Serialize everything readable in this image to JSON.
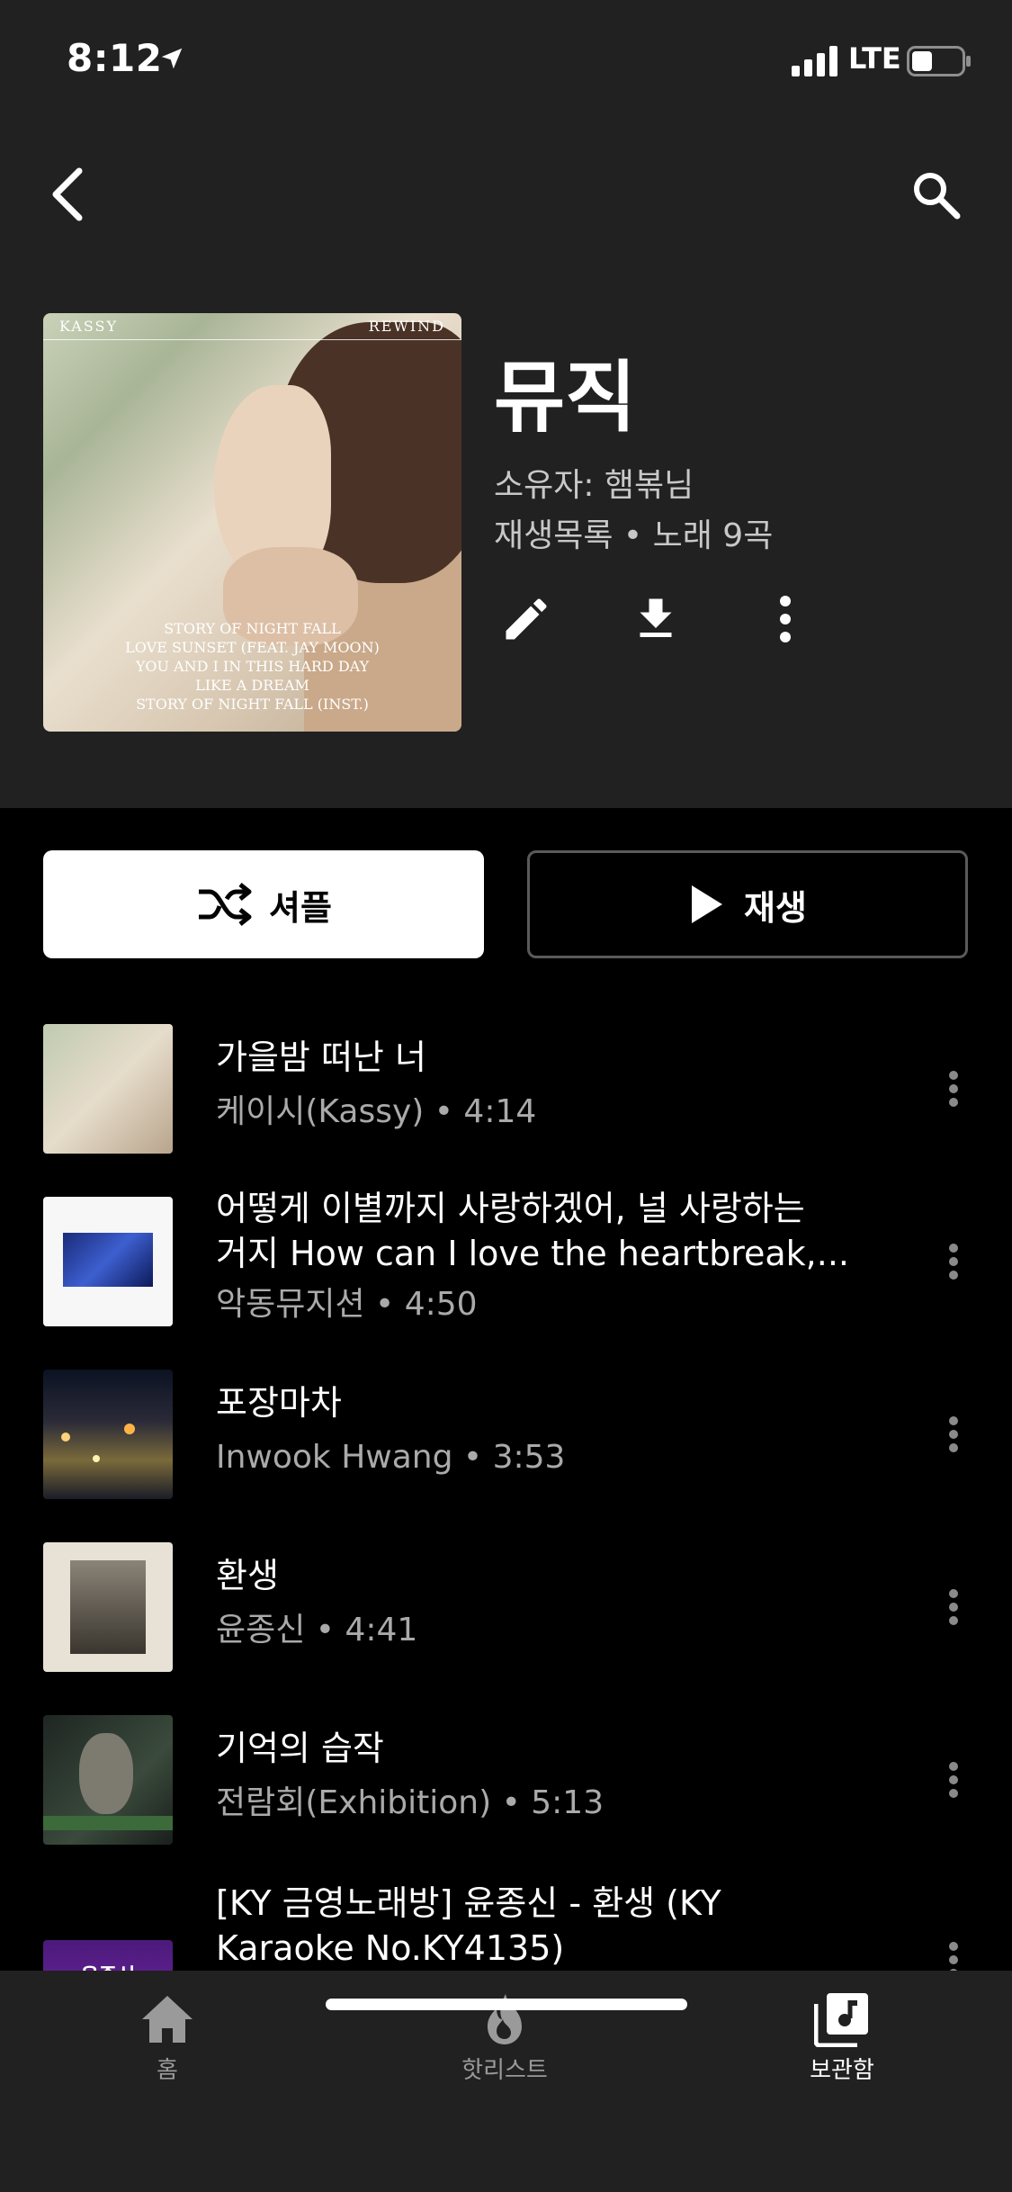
{
  "status_bar": {
    "time": "8:12",
    "network": "LTE",
    "icons": [
      "location-arrow-icon",
      "signal-icon",
      "battery-icon"
    ]
  },
  "header": {
    "back_icon": "back-arrow-icon",
    "search_icon": "search-icon"
  },
  "playlist": {
    "title": "뮤직",
    "owner": "소유자: 햄볶님",
    "meta": "재생목록 • 노래 9곡",
    "actions": [
      "edit-icon",
      "download-icon",
      "more-vert-icon"
    ],
    "cover": {
      "brand_left": "KASSY",
      "brand_right": "REWIND",
      "tracks": [
        "STORY OF NIGHT FALL",
        "LOVE SUNSET (FEAT. JAY MOON)",
        "YOU AND I IN THIS HARD DAY",
        "LIKE A DREAM",
        "STORY OF NIGHT FALL (INST.)"
      ]
    }
  },
  "buttons": {
    "shuffle_label": "셔플",
    "play_label": "재생"
  },
  "songs": [
    {
      "title": "가을밤 떠난 너",
      "subtitle": "케이시(Kassy) • 4:14"
    },
    {
      "title_line1": "어떻게 이별까지 사랑하겠어, 널 사랑하는",
      "title_line2": "거지 How can I love the heartbreak,...",
      "subtitle": "악동뮤지션 • 4:50"
    },
    {
      "title": "포장마차",
      "subtitle": "Inwook Hwang • 3:53"
    },
    {
      "title": "환생",
      "subtitle": "윤종신 • 4:41"
    },
    {
      "title": "기억의 습작",
      "subtitle": "전람회(Exhibition) • 5:13"
    },
    {
      "title_line1": "[KY 금영노래방] 윤종신 - 환생 (KY",
      "title_line2": "Karaoke No.KY4135)",
      "thumb_text": "윤종신"
    }
  ],
  "bottom_nav": {
    "home": "홈",
    "hotlist": "핫리스트",
    "library": "보관함"
  },
  "colors": {
    "header_bg": "#212121",
    "page_bg": "#000000",
    "secondary_text": "#aaaaaa",
    "active_nav": "#ffffff",
    "inactive_nav": "#9a9a9a"
  }
}
